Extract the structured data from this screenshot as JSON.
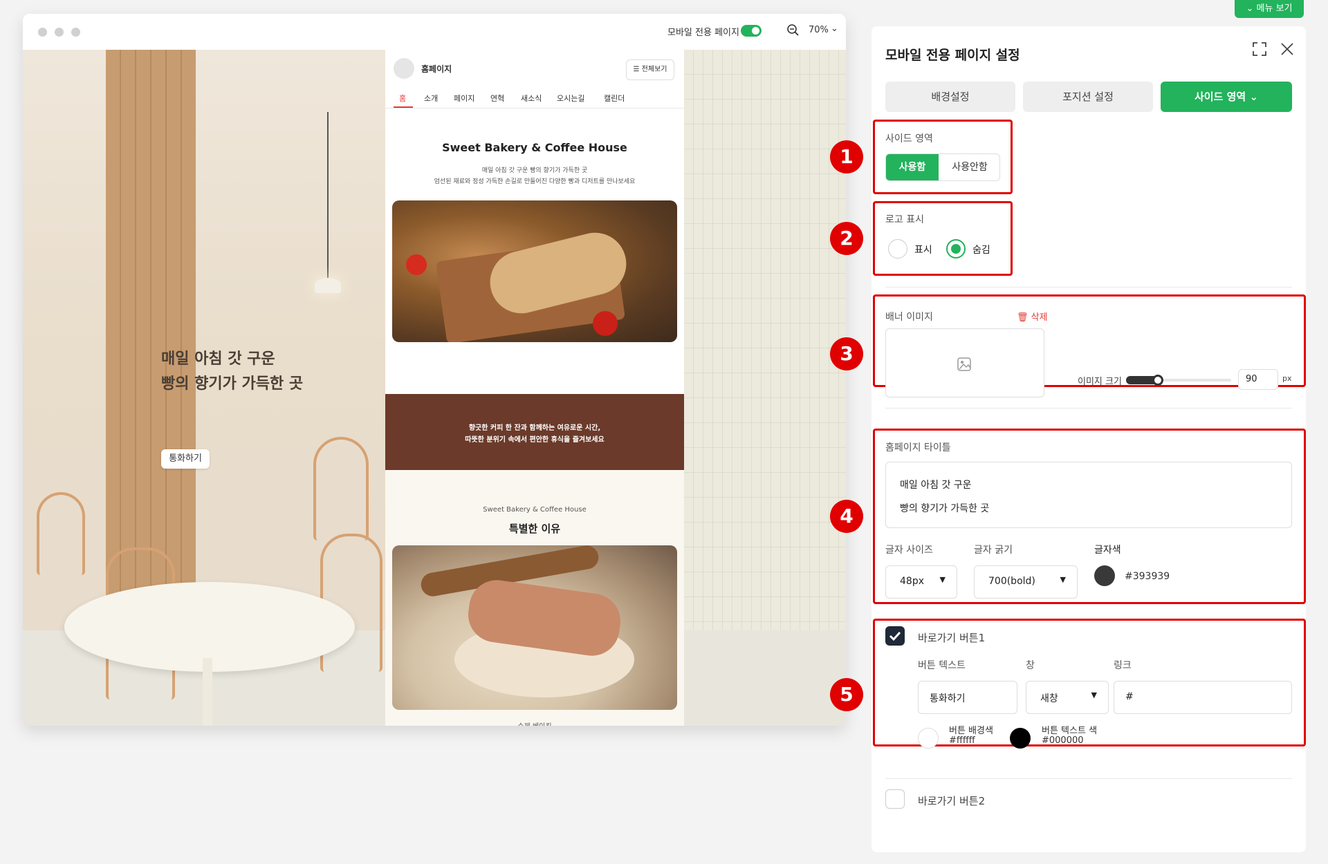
{
  "browser": {
    "mobile_only_label": "모바일 전용 페이지",
    "zoom": "70%"
  },
  "hero": {
    "line1": "매일 아침 갓 구운",
    "line2": "빵의 향기가 가득한 곳",
    "button": "통화하기"
  },
  "mobile": {
    "site_name": "홈페이지",
    "menu_button": "전체보기",
    "nav": [
      "홈",
      "소개",
      "페이지",
      "연혁",
      "새소식",
      "오시는길",
      "캘린더"
    ],
    "title": "Sweet Bakery & Coffee House",
    "sub1": "매일 아침 갓 구운 빵의 향기가 가득한 곳",
    "sub2": "엄선된 재료와 정성 가득한 손길로 만들어진 다양한 빵과 디저트를 만나보세요",
    "banner_line1": "향긋한 커피 한 잔과 함께하는 여유로운 시간,",
    "banner_line2": "따뜻한 분위기 속에서 편안한 휴식을 즐겨보세요",
    "section_kicker": "Sweet Bakery & Coffee House",
    "section_title": "특별한 이유",
    "bottom_caption": "수제 베이킹"
  },
  "panel": {
    "menu_tab": "메뉴 보기",
    "title": "모바일 전용 페이지 설정",
    "tabs": [
      "배경설정",
      "포지션 설정",
      "사이드 영역"
    ],
    "side_area": {
      "label": "사이드 영역",
      "on": "사용함",
      "off": "사용안함"
    },
    "logo": {
      "label": "로고 표시",
      "show": "표시",
      "hide": "숨김"
    },
    "banner": {
      "label": "배너 이미지",
      "delete": "삭제",
      "size_label": "이미지 크기",
      "size_value": "90",
      "unit": "px",
      "size_level": 0.2
    },
    "homepage_title": {
      "label": "홈페이지 타이틀",
      "line1": "매일 아침 갓 구운",
      "line2": "빵의 향기가 가득한 곳",
      "font_size_label": "글자 사이즈",
      "font_size": "48px",
      "font_weight_label": "글자 굵기",
      "font_weight": "700(bold)",
      "color_label": "글자색",
      "color": "#393939"
    },
    "shortcut1": {
      "label": "바로가기 버튼1",
      "text_label": "버튼 텍스트",
      "text_value": "통화하기",
      "window_label": "창",
      "window_value": "새창",
      "link_label": "링크",
      "link_value": "#",
      "bg_label": "버튼 배경색",
      "bg_value": "#ffffff",
      "fg_label": "버튼 텍스트 색",
      "fg_value": "#000000"
    },
    "shortcut2": {
      "label": "바로가기 버튼2"
    }
  },
  "markers": [
    "1",
    "2",
    "3",
    "4",
    "5"
  ],
  "colors": {
    "accent": "#22b35c",
    "annotation": "#e00000",
    "banner_brown": "#6b3a2a"
  }
}
